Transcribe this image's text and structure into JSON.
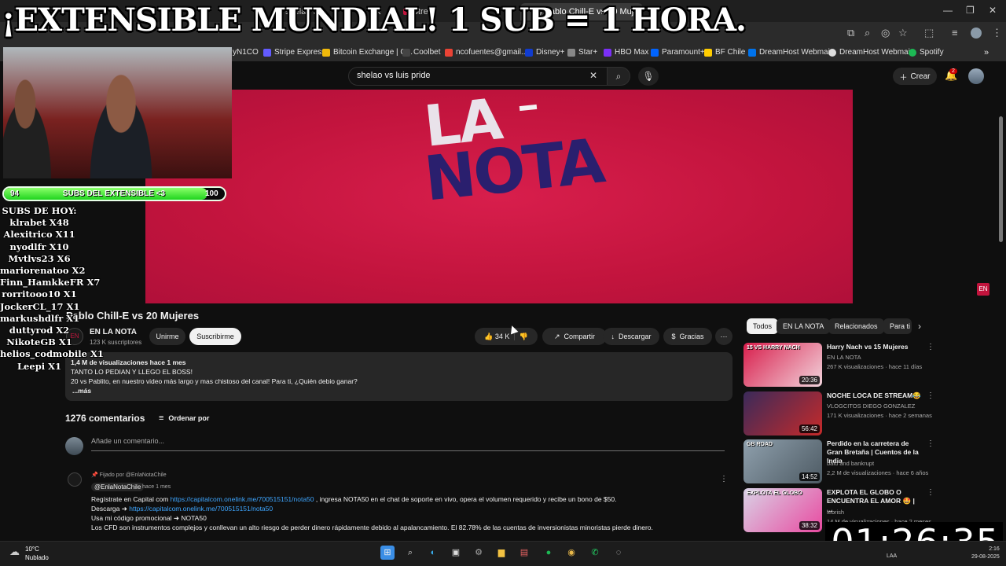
{
  "overlay": {
    "title": "¡EXTENSIBLE MUNDIAL! 1 SUB = 1 HORA.",
    "subs_bar": {
      "left": "94",
      "label": "SUBS DEL EXTENSIBLE <3",
      "right": "100",
      "fill_fraction": 0.92
    },
    "subs_list": [
      "SUBS DE HOY:",
      "klrabet X48",
      "Alexitrico X11",
      "nyodlfr X10",
      "Mvtlvs23 X6",
      "mariorenatoo X2",
      "Finn_HamkkeFR X7",
      "rorritooo10 X1",
      "JockerCL_17 X1",
      "markushdlfr X1",
      "duttyrod X2",
      "NikoteGB X1",
      "helios_codmobile X1",
      "Leepi X1"
    ],
    "timer": "01:26:35"
  },
  "browser": {
    "tabs": [
      {
        "label": "shelao Str",
        "active": false
      },
      {
        "label": "Stre",
        "active": false
      },
      {
        "label": "(2) Pablo Chill-E vs 20 Muje",
        "active": true
      }
    ],
    "new_tab": "+",
    "bookmarks": [
      {
        "label": "yN1CO",
        "color": "#5555cc"
      },
      {
        "label": "Stripe Express",
        "color": "#635bff"
      },
      {
        "label": "Bitcoin Exchange | C...",
        "color": "#f0b90b"
      },
      {
        "label": "Coolbet",
        "color": "#444444"
      },
      {
        "label": "ncofuentes@gmail....",
        "color": "#ea4335"
      },
      {
        "label": "Disney+",
        "color": "#113ccf"
      },
      {
        "label": "Star+",
        "color": "#888888"
      },
      {
        "label": "HBO Max",
        "color": "#7b2ff7"
      },
      {
        "label": "Paramount+",
        "color": "#0064ff"
      },
      {
        "label": "BF Chile",
        "color": "#ffcc00"
      },
      {
        "label": "DreamHost Webmai...",
        "color": "#0073ec"
      },
      {
        "label": "DreamHost Webmai...",
        "color": "#dddddd"
      },
      {
        "label": "Spotify",
        "color": "#1db954"
      }
    ]
  },
  "youtube": {
    "search": {
      "value": "shelao vs luis pride"
    },
    "create_label": "Crear",
    "notif_count": "2",
    "video": {
      "line1": "LA",
      "line2": "NOTA"
    },
    "title": "Pablo Chill-E vs 20 Mujeres",
    "channel": {
      "name": "EN LA NOTA",
      "subs": "123 K suscriptores"
    },
    "join_label": "Unirme",
    "subscribe_label": "Suscribirme",
    "actions": {
      "likes": "34 K",
      "share": "Compartir",
      "download": "Descargar",
      "thanks": "Gracias"
    },
    "description": {
      "meta": "1,4 M de visualizaciones  hace 1 mes",
      "line1": "TANTO LO PEDIAN Y LLEGO EL BOSS!",
      "line2": "20 vs Pablito, en nuestro video más largo y mas chistoso del canal! Para ti, ¿Quién debio ganar?",
      "more": "...más"
    },
    "comments": {
      "count": "1276 comentarios",
      "sort_label": "Ordenar por",
      "placeholder": "Añade un comentario...",
      "pinned": {
        "pinned_by": "Fijado por @EnlaNotaChile",
        "handle": "@EnlaNotaChile",
        "time": "hace 1 mes",
        "l1a": "Regístrate en Capital com ",
        "l1link": "https://capitalcom.onelink.me/700515151/nota50",
        "l1b": " , ingresa NOTA50 en el chat de soporte en vivo, opera el volumen requerido y recibe un bono de $50.",
        "l2a": "Descarga ➜ ",
        "l2link": "https://capitalcom.onelink.me/700515151/nota50",
        "l3": "Usa mi código promocional ➜ NOTA50",
        "l4": "Los CFD son instrumentos complejos y conllevan un alto riesgo de perder dinero rápidamente debido al apalancamiento. El 82.78% de las cuentas de inversionistas minoristas pierde dinero."
      }
    },
    "chips": [
      "Todos",
      "EN LA NOTA",
      "Relacionados",
      "Para ti"
    ],
    "recommendations": [
      {
        "title": "Harry Nach vs 15 Mujeres",
        "channel": "EN LA NOTA",
        "meta": "267 K visualizaciones · hace 11 días",
        "duration": "20:36",
        "thumb_text": "15 VS HARRY NACH",
        "colors": [
          "#d81e4c",
          "#f2d4dc"
        ]
      },
      {
        "title": "NOCHE LOCA DE STREAM😂",
        "channel": "VLOGCITOS DIEGO GONZALEZ",
        "meta": "171 K visualizaciones · hace 2 semanas",
        "duration": "56:42",
        "thumb_text": "",
        "colors": [
          "#3a2a5a",
          "#c62a2a"
        ]
      },
      {
        "title": "Perdido en la carretera de Gran Bretaña | Cuentos de la India",
        "channel": "bald and bankrupt",
        "meta": "2,2 M de visualizaciones · hace 6 años",
        "duration": "14:52",
        "thumb_text": "GB ROAD",
        "colors": [
          "#8fa0ad",
          "#4d5a63"
        ]
      },
      {
        "title": "EXPLOTA EL GLOBO O ENCUENTRA EL AMOR 🤩 | ...",
        "channel": "lebrish",
        "meta": "14 M de visualizaciones · hace 2 meses",
        "duration": "38:32",
        "thumb_text": "EXPLOTA EL GLOBO",
        "colors": [
          "#d9d2e6",
          "#e84aa0"
        ]
      }
    ]
  },
  "taskbar": {
    "weather_temp": "10°C",
    "weather_desc": "Nublado",
    "tray": "LAA",
    "time": "2:16",
    "date": "29-08-2025"
  }
}
